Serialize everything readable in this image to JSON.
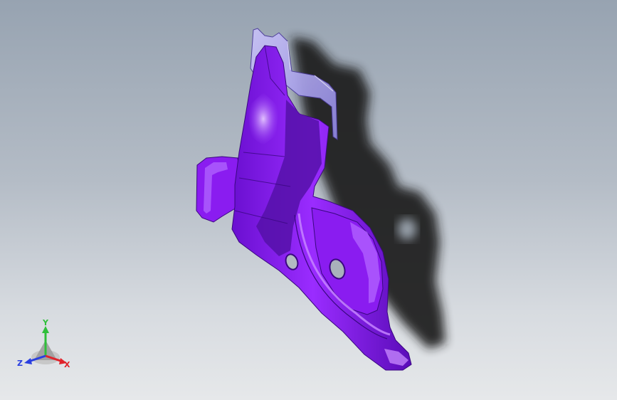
{
  "viewport": {
    "background_top": "#97a3b1",
    "background_bottom": "#e6e8ea"
  },
  "model": {
    "part_color": "#8a1cf0",
    "part_shadow_color": "#5510a8",
    "part_highlight_color": "#c58cff",
    "transparent_tab_color": "#b9b2f2",
    "cast_shadow_color": "#1c1c1e"
  },
  "triad": {
    "x_label": "X",
    "y_label": "Y",
    "z_label": "Z",
    "x_color": "#e0242c",
    "y_color": "#2fbf3a",
    "z_color": "#2a3fe0"
  }
}
